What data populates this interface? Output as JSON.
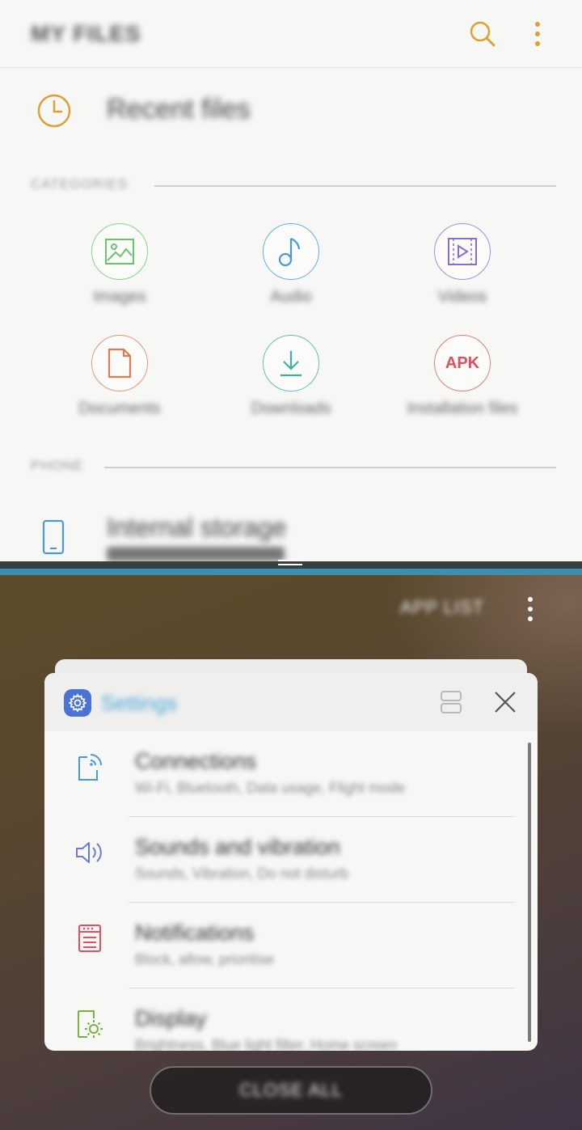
{
  "my_files": {
    "title": "MY FILES",
    "recent_label": "Recent files",
    "categories_header": "CATEGORIES",
    "categories": [
      {
        "label": "Images",
        "icon": "image-icon",
        "color": "#6cc46a"
      },
      {
        "label": "Audio",
        "icon": "music-note-icon",
        "color": "#4a9ad6"
      },
      {
        "label": "Videos",
        "icon": "video-icon",
        "color": "#8a6ad6"
      },
      {
        "label": "Documents",
        "icon": "document-icon",
        "color": "#e07a50"
      },
      {
        "label": "Downloads",
        "icon": "download-icon",
        "color": "#3ab0a0"
      },
      {
        "label": "Installation files",
        "icon": "apk-icon",
        "color": "#e0505a",
        "badge": "APK"
      }
    ],
    "phone_header": "PHONE",
    "storage_label": "Internal storage"
  },
  "recent_apps": {
    "app_list_label": "APP LIST",
    "card": {
      "title": "Settings",
      "items": [
        {
          "title": "Connections",
          "subtitle": "Wi-Fi, Bluetooth, Data usage, Flight mode",
          "icon": "connections-icon",
          "color": "#4a9ad6"
        },
        {
          "title": "Sounds and vibration",
          "subtitle": "Sounds, Vibration, Do not disturb",
          "icon": "speaker-icon",
          "color": "#6a7ad6"
        },
        {
          "title": "Notifications",
          "subtitle": "Block, allow, prioritise",
          "icon": "notifications-icon",
          "color": "#e05060"
        },
        {
          "title": "Display",
          "subtitle": "Brightness, Blue light filter, Home screen",
          "icon": "display-icon",
          "color": "#7ab040"
        }
      ]
    },
    "close_all_label": "CLOSE ALL"
  },
  "colors": {
    "accent_orange": "#e0a030",
    "settings_blue": "#4a73d6"
  }
}
